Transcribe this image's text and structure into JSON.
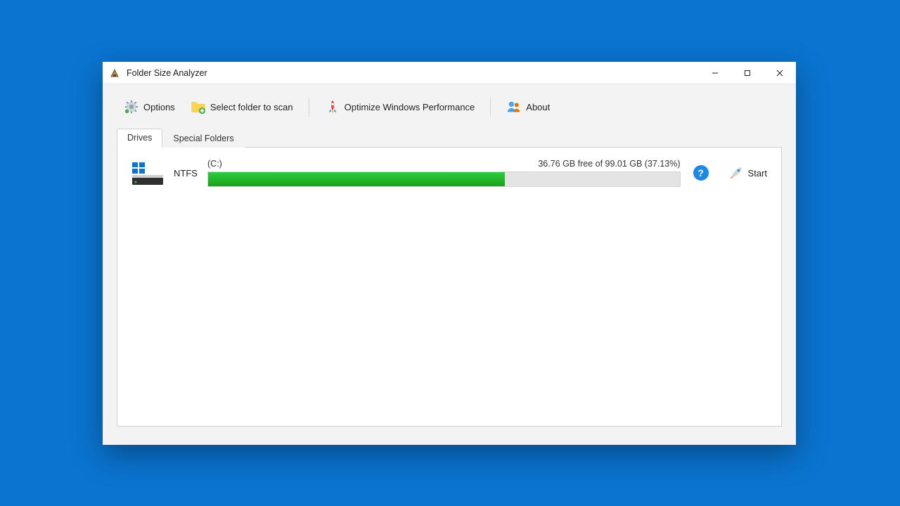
{
  "window": {
    "title": "Folder Size Analyzer"
  },
  "toolbar": {
    "options": "Options",
    "select_folder": "Select folder to scan",
    "optimize": "Optimize Windows Performance",
    "about": "About"
  },
  "tabs": {
    "drives": "Drives",
    "special": "Special Folders",
    "active": "drives"
  },
  "drive": {
    "filesystem": "NTFS",
    "label": "(C:)",
    "free_text": "36.76 GB free of 99.01 GB (37.13%)",
    "used_percent": 62.87,
    "help": "?",
    "start": "Start"
  }
}
